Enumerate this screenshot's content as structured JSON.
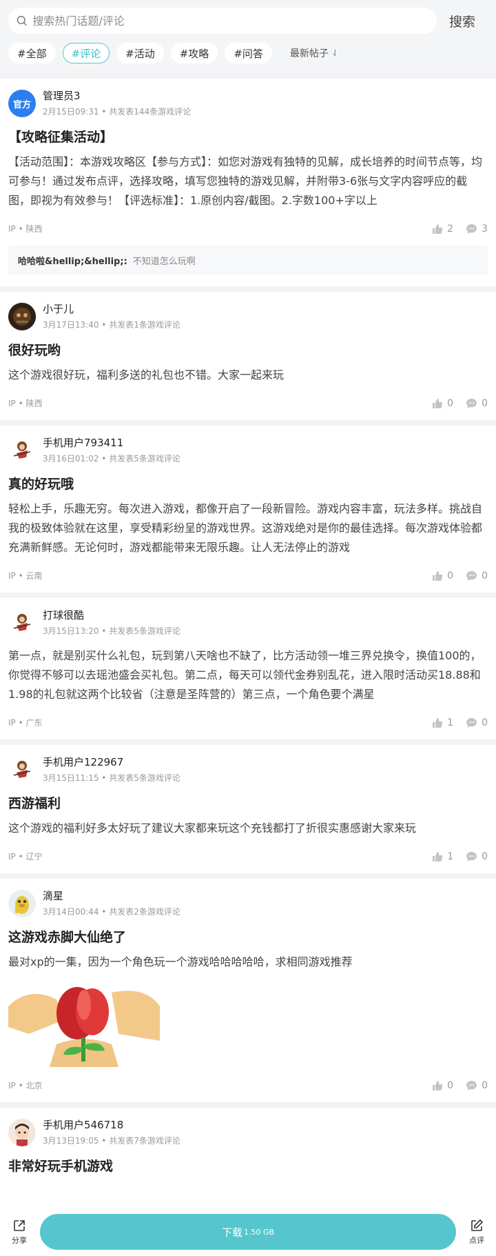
{
  "search": {
    "placeholder": "搜索热门话题/评论",
    "button": "搜索"
  },
  "tabs": [
    {
      "label": "#全部",
      "active": false
    },
    {
      "label": "#评论",
      "active": true
    },
    {
      "label": "#活动",
      "active": false
    },
    {
      "label": "#攻略",
      "active": false
    },
    {
      "label": "#问答",
      "active": false
    }
  ],
  "sort": {
    "label": "最新帖子",
    "icon": "sort-arrows-icon"
  },
  "posts": [
    {
      "avatar": "官方",
      "author": "管理员3",
      "meta": "2月15日09:31 • 共发表144条游戏评论",
      "title": "【攻略征集活动】",
      "body": "【活动范围】：本游戏攻略区【参与方式】：如您对游戏有独特的见解，成长培养的时间节点等，均可参与！通过发布点评，选择攻略，填写您独特的游戏见解，并附带3-6张与文字内容呼应的截图，即视为有效参与！【评选标准】：1.原创内容/截图。2.字数100+字以上",
      "ip": "IP • 陕西",
      "likes": "2",
      "comments": "3",
      "reply": {
        "user": "哈哈啦&hellip;&hellip;:",
        "text": "不知道怎么玩啊"
      }
    },
    {
      "author": "小于儿",
      "meta": "3月17日13:40 • 共发表1条游戏评论",
      "title": "很好玩哟",
      "body": "这个游戏很好玩，福利多送的礼包也不错。大家一起来玩",
      "ip": "IP • 陕西",
      "likes": "0",
      "comments": "0"
    },
    {
      "author": "手机用户793411",
      "meta": "3月16日01:02 • 共发表5条游戏评论",
      "title": "真的好玩哦",
      "body": "轻松上手，乐趣无穷。每次进入游戏，都像开启了一段新冒险。游戏内容丰富，玩法多样。挑战自我的极致体验就在这里，享受精彩纷呈的游戏世界。这游戏绝对是你的最佳选择。每次游戏体验都充满新鲜感。无论何时，游戏都能带来无限乐趣。让人无法停止的游戏",
      "ip": "IP • 云南",
      "likes": "0",
      "comments": "0"
    },
    {
      "author": "打球很酷",
      "meta": "3月15日13:20 • 共发表5条游戏评论",
      "title": "",
      "body": "第一点，就是别买什么礼包，玩到第八天啥也不缺了，比方活动领一堆三界兑换令，换值100的，你觉得不够可以去瑶池盛会买礼包。第二点，每天可以领代金券别乱花，进入限时活动买18.88和1.98的礼包就这两个比较省（注意是圣阵营的）第三点，一个角色要个满星",
      "ip": "IP • 广东",
      "likes": "1",
      "comments": "0"
    },
    {
      "author": "手机用户122967",
      "meta": "3月15日11:15 • 共发表5条游戏评论",
      "title": "西游福利",
      "body": "这个游戏的福利好多太好玩了建议大家都来玩这个充钱都打了折很实惠感谢大家来玩",
      "ip": "IP • 辽宁",
      "likes": "1",
      "comments": "0"
    },
    {
      "author": "滴星",
      "meta": "3月14日00:44 • 共发表2条游戏评论",
      "title": "这游戏赤脚大仙绝了",
      "body": "最对xp的一集，因为一个角色玩一个游戏哈哈哈哈哈，求相同游戏推荐",
      "ip": "IP • 北京",
      "likes": "0",
      "comments": "0"
    },
    {
      "author": "手机用户546718",
      "meta": "3月13日19:05 • 共发表7条游戏评论",
      "title": "非常好玩手机游戏"
    }
  ],
  "bottom": {
    "share": "分享",
    "download": "下载",
    "size": "1.50 GB",
    "review": "点评"
  },
  "colors": {
    "accent": "#55c6cd",
    "official": "#2a7ef0"
  }
}
